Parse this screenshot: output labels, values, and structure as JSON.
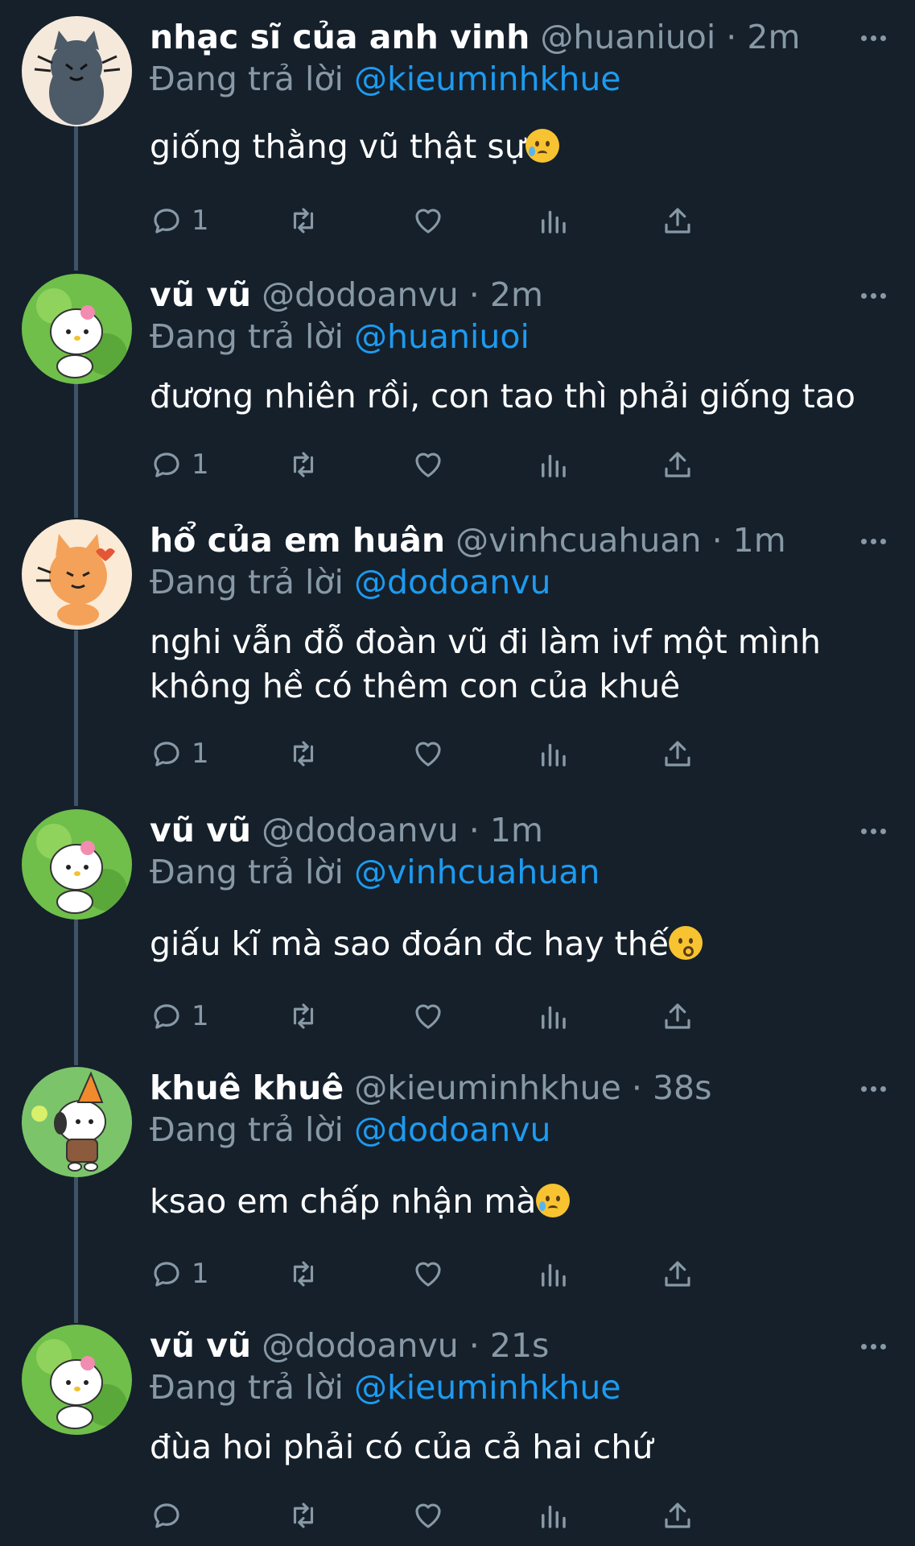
{
  "colors": {
    "background": "#15202b",
    "secondary": "#8899a6",
    "accent": "#1d9bf0",
    "thread_line": "#3d5466"
  },
  "reply_prefix": "Đang trả lời",
  "tweets": [
    {
      "name": "nhạc sĩ của anh vinh",
      "handle": "@huaniuoi",
      "time": "2m",
      "reply_to": "@kieuminhkhue",
      "text": "giống thằng vũ thật sự",
      "emoji": "tearful-smile-emoji",
      "reply_count": "1",
      "avatar": "grey-cat-avatar"
    },
    {
      "name": "vũ vũ",
      "handle": "@dodoanvu",
      "time": "2m",
      "reply_to": "@huaniuoi",
      "text": "đương nhiên rồi, con tao thì phải giống tao",
      "reply_count": "1",
      "avatar": "green-kitty-avatar"
    },
    {
      "name": "hổ của em huân",
      "handle": "@vinhcuahuan",
      "time": "1m",
      "reply_to": "@dodoanvu",
      "text": "nghi vẫn đỗ đoàn vũ đi làm ivf một mình\nkhông hề có thêm con của khuê",
      "reply_count": "1",
      "avatar": "orange-cat-avatar"
    },
    {
      "name": "vũ vũ",
      "handle": "@dodoanvu",
      "time": "1m",
      "reply_to": "@vinhcuahuan",
      "text": "giấu kĩ mà sao đoán đc hay thế",
      "emoji": "kissing-emoji",
      "reply_count": "1",
      "avatar": "green-kitty-avatar"
    },
    {
      "name": "khuê khuê",
      "handle": "@kieuminhkhue",
      "time": "38s",
      "reply_to": "@dodoanvu",
      "text": "ksao em chấp nhận mà",
      "emoji": "tearful-smile-emoji",
      "reply_count": "1",
      "avatar": "pochacco-avatar"
    },
    {
      "name": "vũ vũ",
      "handle": "@dodoanvu",
      "time": "21s",
      "reply_to": "@kieuminhkhue",
      "text": "đùa hoi phải có của cả hai chứ",
      "reply_count": "",
      "avatar": "green-kitty-avatar"
    }
  ]
}
